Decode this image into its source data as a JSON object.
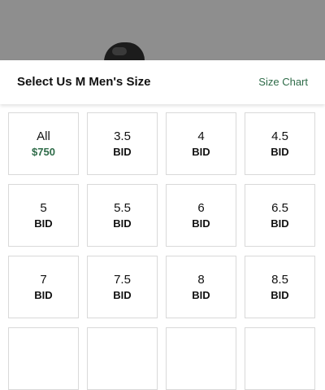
{
  "header": {
    "title": "Select Us M Men's Size",
    "size_chart_label": "Size Chart"
  },
  "colors": {
    "accent_green": "#2e6b48",
    "backdrop_gray": "#8e8e8e"
  },
  "sizes": [
    {
      "size": "All",
      "price": "$750"
    },
    {
      "size": "3.5",
      "price": "BID"
    },
    {
      "size": "4",
      "price": "BID"
    },
    {
      "size": "4.5",
      "price": "BID"
    },
    {
      "size": "5",
      "price": "BID"
    },
    {
      "size": "5.5",
      "price": "BID"
    },
    {
      "size": "6",
      "price": "BID"
    },
    {
      "size": "6.5",
      "price": "BID"
    },
    {
      "size": "7",
      "price": "BID"
    },
    {
      "size": "7.5",
      "price": "BID"
    },
    {
      "size": "8",
      "price": "BID"
    },
    {
      "size": "8.5",
      "price": "BID"
    },
    {
      "size": "",
      "price": ""
    },
    {
      "size": "",
      "price": ""
    },
    {
      "size": "",
      "price": ""
    },
    {
      "size": "",
      "price": ""
    }
  ]
}
